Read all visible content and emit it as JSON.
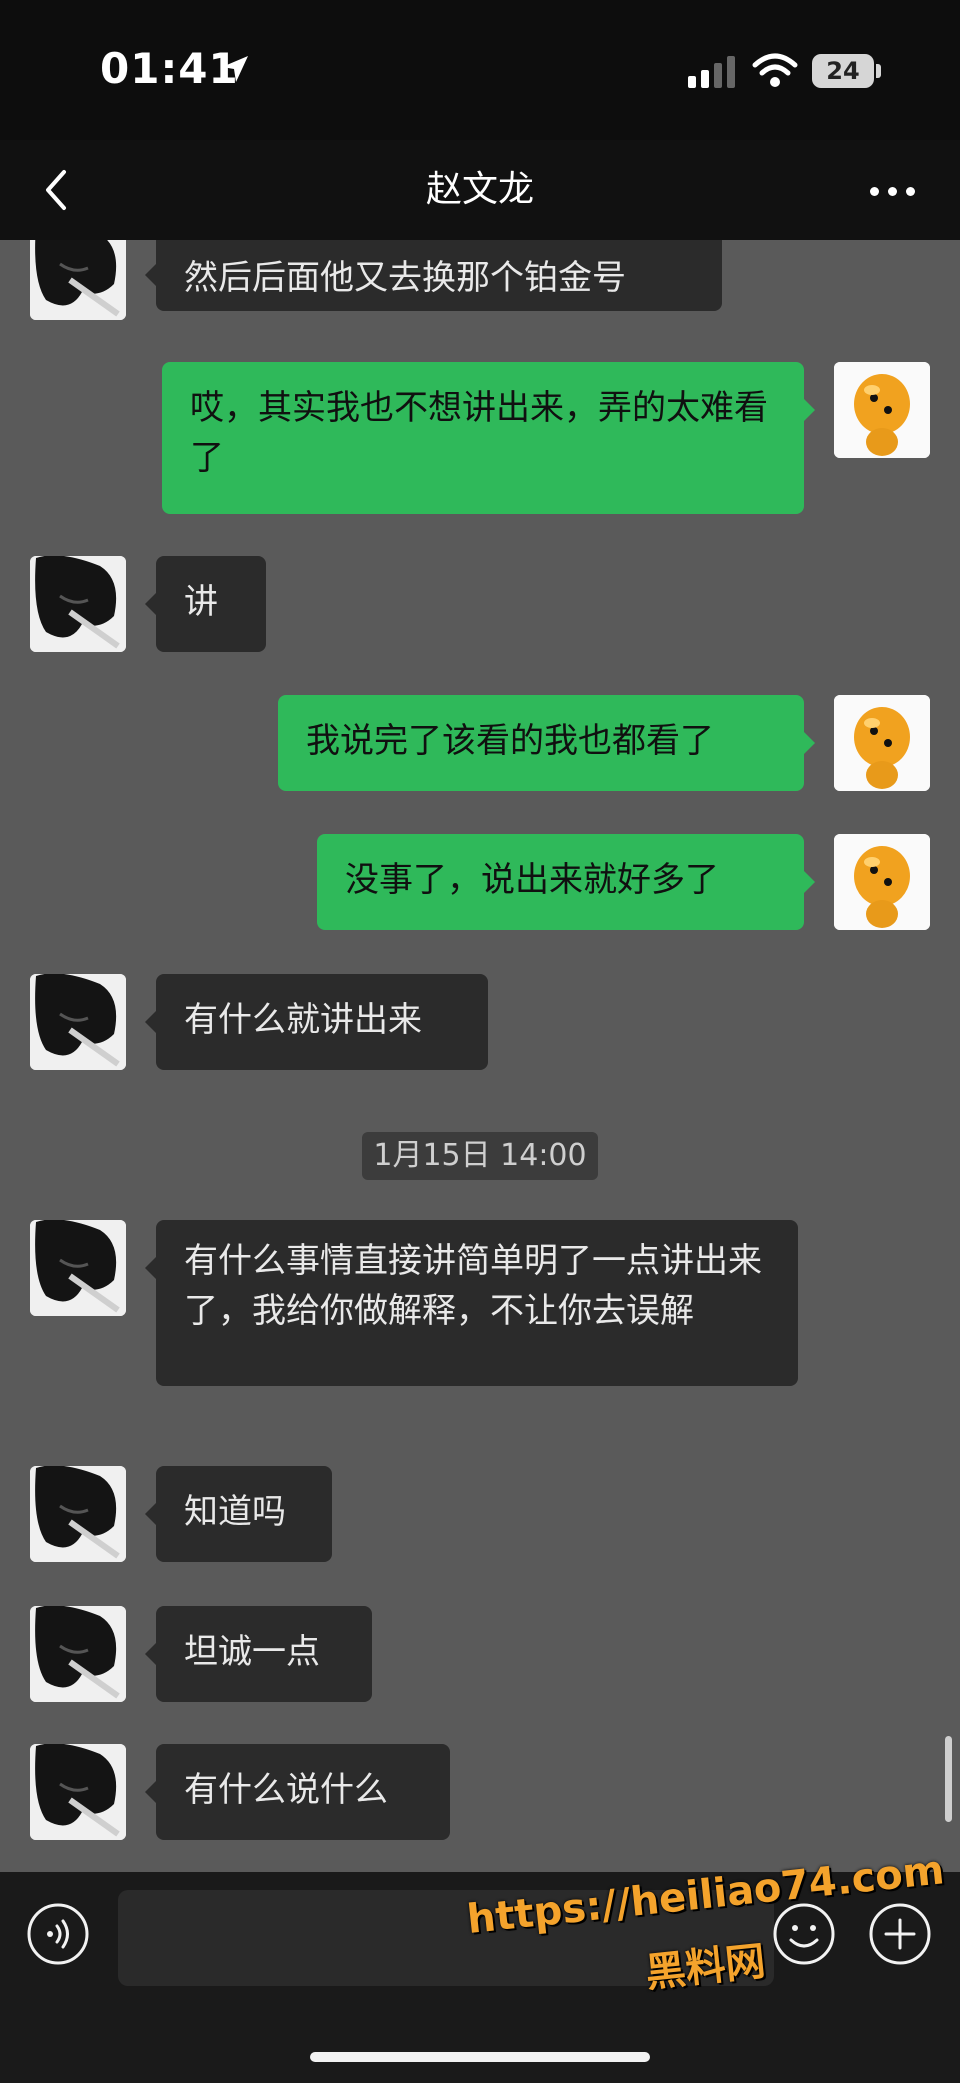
{
  "status_bar": {
    "time": "01:41",
    "battery_level": "24"
  },
  "header": {
    "title": "赵文龙"
  },
  "messages": [
    {
      "side": "in",
      "text": "然后后面他又去换那个铂金号"
    },
    {
      "side": "out",
      "text": "哎，其实我也不想讲出来，弄的太难看了"
    },
    {
      "side": "in",
      "text": "讲"
    },
    {
      "side": "out",
      "text": "我说完了该看的我也都看了"
    },
    {
      "side": "out",
      "text": "没事了，说出来就好多了"
    },
    {
      "side": "in",
      "text": "有什么就讲出来"
    },
    {
      "side": "in",
      "text": "有什么事情直接讲简单明了一点讲出来了，我给你做解释，不让你去误解"
    },
    {
      "side": "in",
      "text": "知道吗"
    },
    {
      "side": "in",
      "text": "坦诚一点"
    },
    {
      "side": "in",
      "text": "有什么说什么"
    }
  ],
  "timestamp": "1月15日 14:00",
  "watermark": {
    "url": "https://heiliao74.com",
    "name": "黑料网"
  },
  "colors": {
    "outgoing_bubble": "#2fb95a",
    "incoming_bubble": "#2b2b2b",
    "chat_background": "#5a5a5a"
  },
  "icons": [
    "back-icon",
    "more-icon",
    "voice-icon",
    "emoji-icon",
    "add-icon",
    "location-icon",
    "signal-icon",
    "wifi-icon"
  ]
}
